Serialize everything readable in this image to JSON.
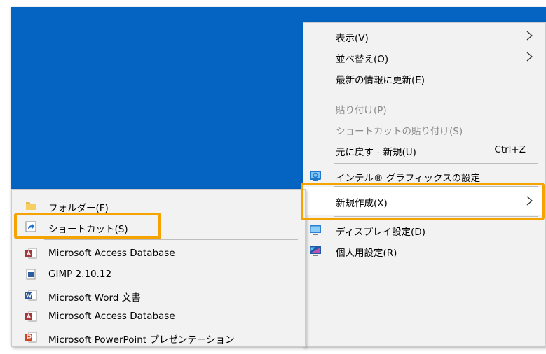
{
  "context_menu": {
    "items": [
      {
        "label": "表示(V)",
        "has_submenu": true,
        "disabled": false
      },
      {
        "label": "並べ替え(O)",
        "has_submenu": true,
        "disabled": false
      },
      {
        "label": "最新の情報に更新(E)",
        "has_submenu": false,
        "disabled": false
      },
      {
        "label": "貼り付け(P)",
        "has_submenu": false,
        "disabled": true
      },
      {
        "label": "ショートカットの貼り付け(S)",
        "has_submenu": false,
        "disabled": true
      },
      {
        "label": "元に戻す - 新規(U)",
        "accelerator": "Ctrl+Z",
        "has_submenu": false,
        "disabled": false
      },
      {
        "label": "インテル® グラフィックスの設定",
        "icon": "intel-graphics-icon"
      },
      {
        "label": "新規作成(X)",
        "has_submenu": true,
        "highlighted": true
      },
      {
        "label": "ディスプレイ設定(D)",
        "icon": "display-settings-icon"
      },
      {
        "label": "個人用設定(R)",
        "icon": "personalize-icon"
      }
    ]
  },
  "new_submenu": {
    "items": [
      {
        "label": "フォルダー(F)",
        "icon": "folder-icon"
      },
      {
        "label": "ショートカット(S)",
        "icon": "shortcut-icon",
        "highlighted": true
      },
      {
        "label": "Microsoft Access Database",
        "icon": "access-icon"
      },
      {
        "label": "GIMP 2.10.12",
        "icon": "gimp-image-icon"
      },
      {
        "label": "Microsoft Word 文書",
        "icon": "word-icon"
      },
      {
        "label": "Microsoft Access Database",
        "icon": "access-icon"
      },
      {
        "label": "Microsoft PowerPoint プレゼンテーション",
        "icon": "powerpoint-icon"
      }
    ]
  },
  "colors": {
    "desktop": "#0563c1",
    "menu_background": "#f2f2f2",
    "highlight_outline": "#f5a300",
    "disabled_text": "#8a8a8a"
  }
}
